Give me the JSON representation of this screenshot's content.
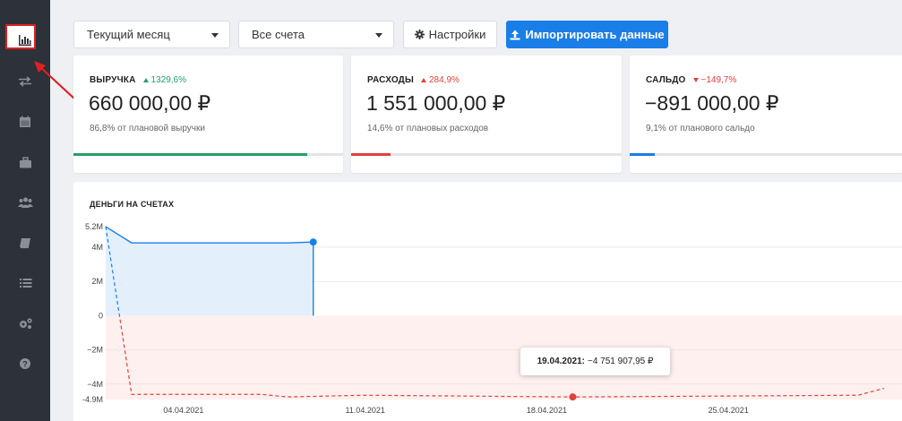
{
  "sidebar": {
    "items": [
      {
        "icon": "bar-chart-icon",
        "active": true
      },
      {
        "icon": "transfer-arrows-icon"
      },
      {
        "icon": "calendar-icon"
      },
      {
        "icon": "briefcase-icon"
      },
      {
        "icon": "users-icon"
      },
      {
        "icon": "book-icon"
      },
      {
        "icon": "list-icon"
      },
      {
        "icon": "gears-icon"
      },
      {
        "icon": "help-icon"
      }
    ]
  },
  "toolbar": {
    "period": "Текущий месяц",
    "accounts": "Все счета",
    "settings_label": "Настройки",
    "import_label": "Импортировать данные"
  },
  "cards": {
    "revenue": {
      "label": "ВЫРУЧКА",
      "delta": "1329,6%",
      "amount": "660 000,00 ₽",
      "sub": "86,8% от плановой выручки",
      "progress": 0.868,
      "color": "#22a06b"
    },
    "expenses": {
      "label": "РАСХОДЫ",
      "delta": "284,9%",
      "amount": "1 551 000,00 ₽",
      "sub": "14,6% от плановых расходов",
      "progress": 0.146,
      "color": "#e0413b"
    },
    "balance": {
      "label": "САЛЬДО",
      "delta": "−149,7%",
      "amount": "−891 000,00 ₽",
      "sub": "9,1% от планового сальдо",
      "progress": 0.091,
      "color": "#1a7ee8"
    }
  },
  "chart": {
    "title": "ДЕНЬГИ НА СЧЕТАХ",
    "tooltip_date": "19.04.2021:",
    "tooltip_value": "−4 751 907,95 ₽"
  },
  "chart_data": {
    "type": "area",
    "title": "ДЕНЬГИ НА СЧЕТАХ",
    "y_ticks": [
      "5.2M",
      "4M",
      "2M",
      "0",
      "−2M",
      "−4M",
      "-4.9M"
    ],
    "x_ticks": [
      "04.04.2021",
      "11.04.2021",
      "18.04.2021",
      "25.04.2021"
    ],
    "ylim": [
      -4900000,
      5200000
    ],
    "xlim": [
      "2021-04-01",
      "2021-05-01"
    ],
    "series": [
      {
        "line": "solid",
        "color": "#1a7ee8",
        "points": [
          {
            "x": "2021-04-01",
            "y": 5200000
          },
          {
            "x": "2021-04-02",
            "y": 4250000
          },
          {
            "x": "2021-04-08",
            "y": 4250000
          },
          {
            "x": "2021-04-09",
            "y": 4300000
          }
        ]
      },
      {
        "line": "dashed",
        "color": "#e0413b",
        "points": [
          {
            "x": "2021-04-01",
            "y": 5200000
          },
          {
            "x": "2021-04-02",
            "y": -4600000
          },
          {
            "x": "2021-04-07",
            "y": -4600000
          },
          {
            "x": "2021-04-08",
            "y": -4750000
          },
          {
            "x": "2021-04-11",
            "y": -4650000
          },
          {
            "x": "2021-04-19",
            "y": -4751908
          },
          {
            "x": "2021-04-30",
            "y": -4650000
          },
          {
            "x": "2021-05-01",
            "y": -4250000
          }
        ]
      }
    ],
    "highlight": {
      "x": "2021-04-19",
      "y": -4751908
    }
  }
}
